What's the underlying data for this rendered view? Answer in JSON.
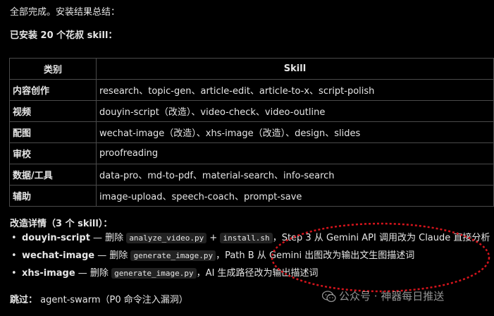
{
  "intro": "全部完成。安装结果总结：",
  "installed_heading": "已安装 20 个花叔 skill：",
  "table": {
    "headers": [
      "类别",
      "Skill"
    ],
    "rows": [
      {
        "category": "内容创作",
        "skills": "research、topic-gen、article-edit、article-to-x、script-polish"
      },
      {
        "category": "视频",
        "skills": "douyin-script（改造）、video-check、video-outline"
      },
      {
        "category": "配图",
        "skills": "wechat-image（改造）、xhs-image（改造）、design、slides"
      },
      {
        "category": "审校",
        "skills": "proofreading"
      },
      {
        "category": "数据/工具",
        "skills": "data-pro、md-to-pdf、material-search、info-search"
      },
      {
        "category": "辅助",
        "skills": "image-upload、speech-coach、prompt-save"
      }
    ]
  },
  "details_heading": "改造详情（3 个 skill）：",
  "details": [
    {
      "name": "douyin-script",
      "sep": " — 删除 ",
      "code1": "analyze_video.py",
      "plus": " + ",
      "code2": "install.sh",
      "rest": "，Step 3 从 Gemini API 调用改为 Claude 直接分析"
    },
    {
      "name": "wechat-image",
      "sep": " — 删除 ",
      "code1": "generate_image.py",
      "rest": "，Path B 从 Gemini 出图改为输出文生图描述词"
    },
    {
      "name": "xhs-image",
      "sep": " — 删除 ",
      "code1": "generate_image.py",
      "rest": "，AI 生成路径改为输出描述词"
    }
  ],
  "skip": {
    "label": "跳过：",
    "value": "agent-swarm（P0 命令注入漏洞）"
  },
  "watermark": "公众号 · 神器每日推送",
  "colors": {
    "background": "#000000",
    "text": "#e6e6e6",
    "annotation": "#d4141c"
  }
}
